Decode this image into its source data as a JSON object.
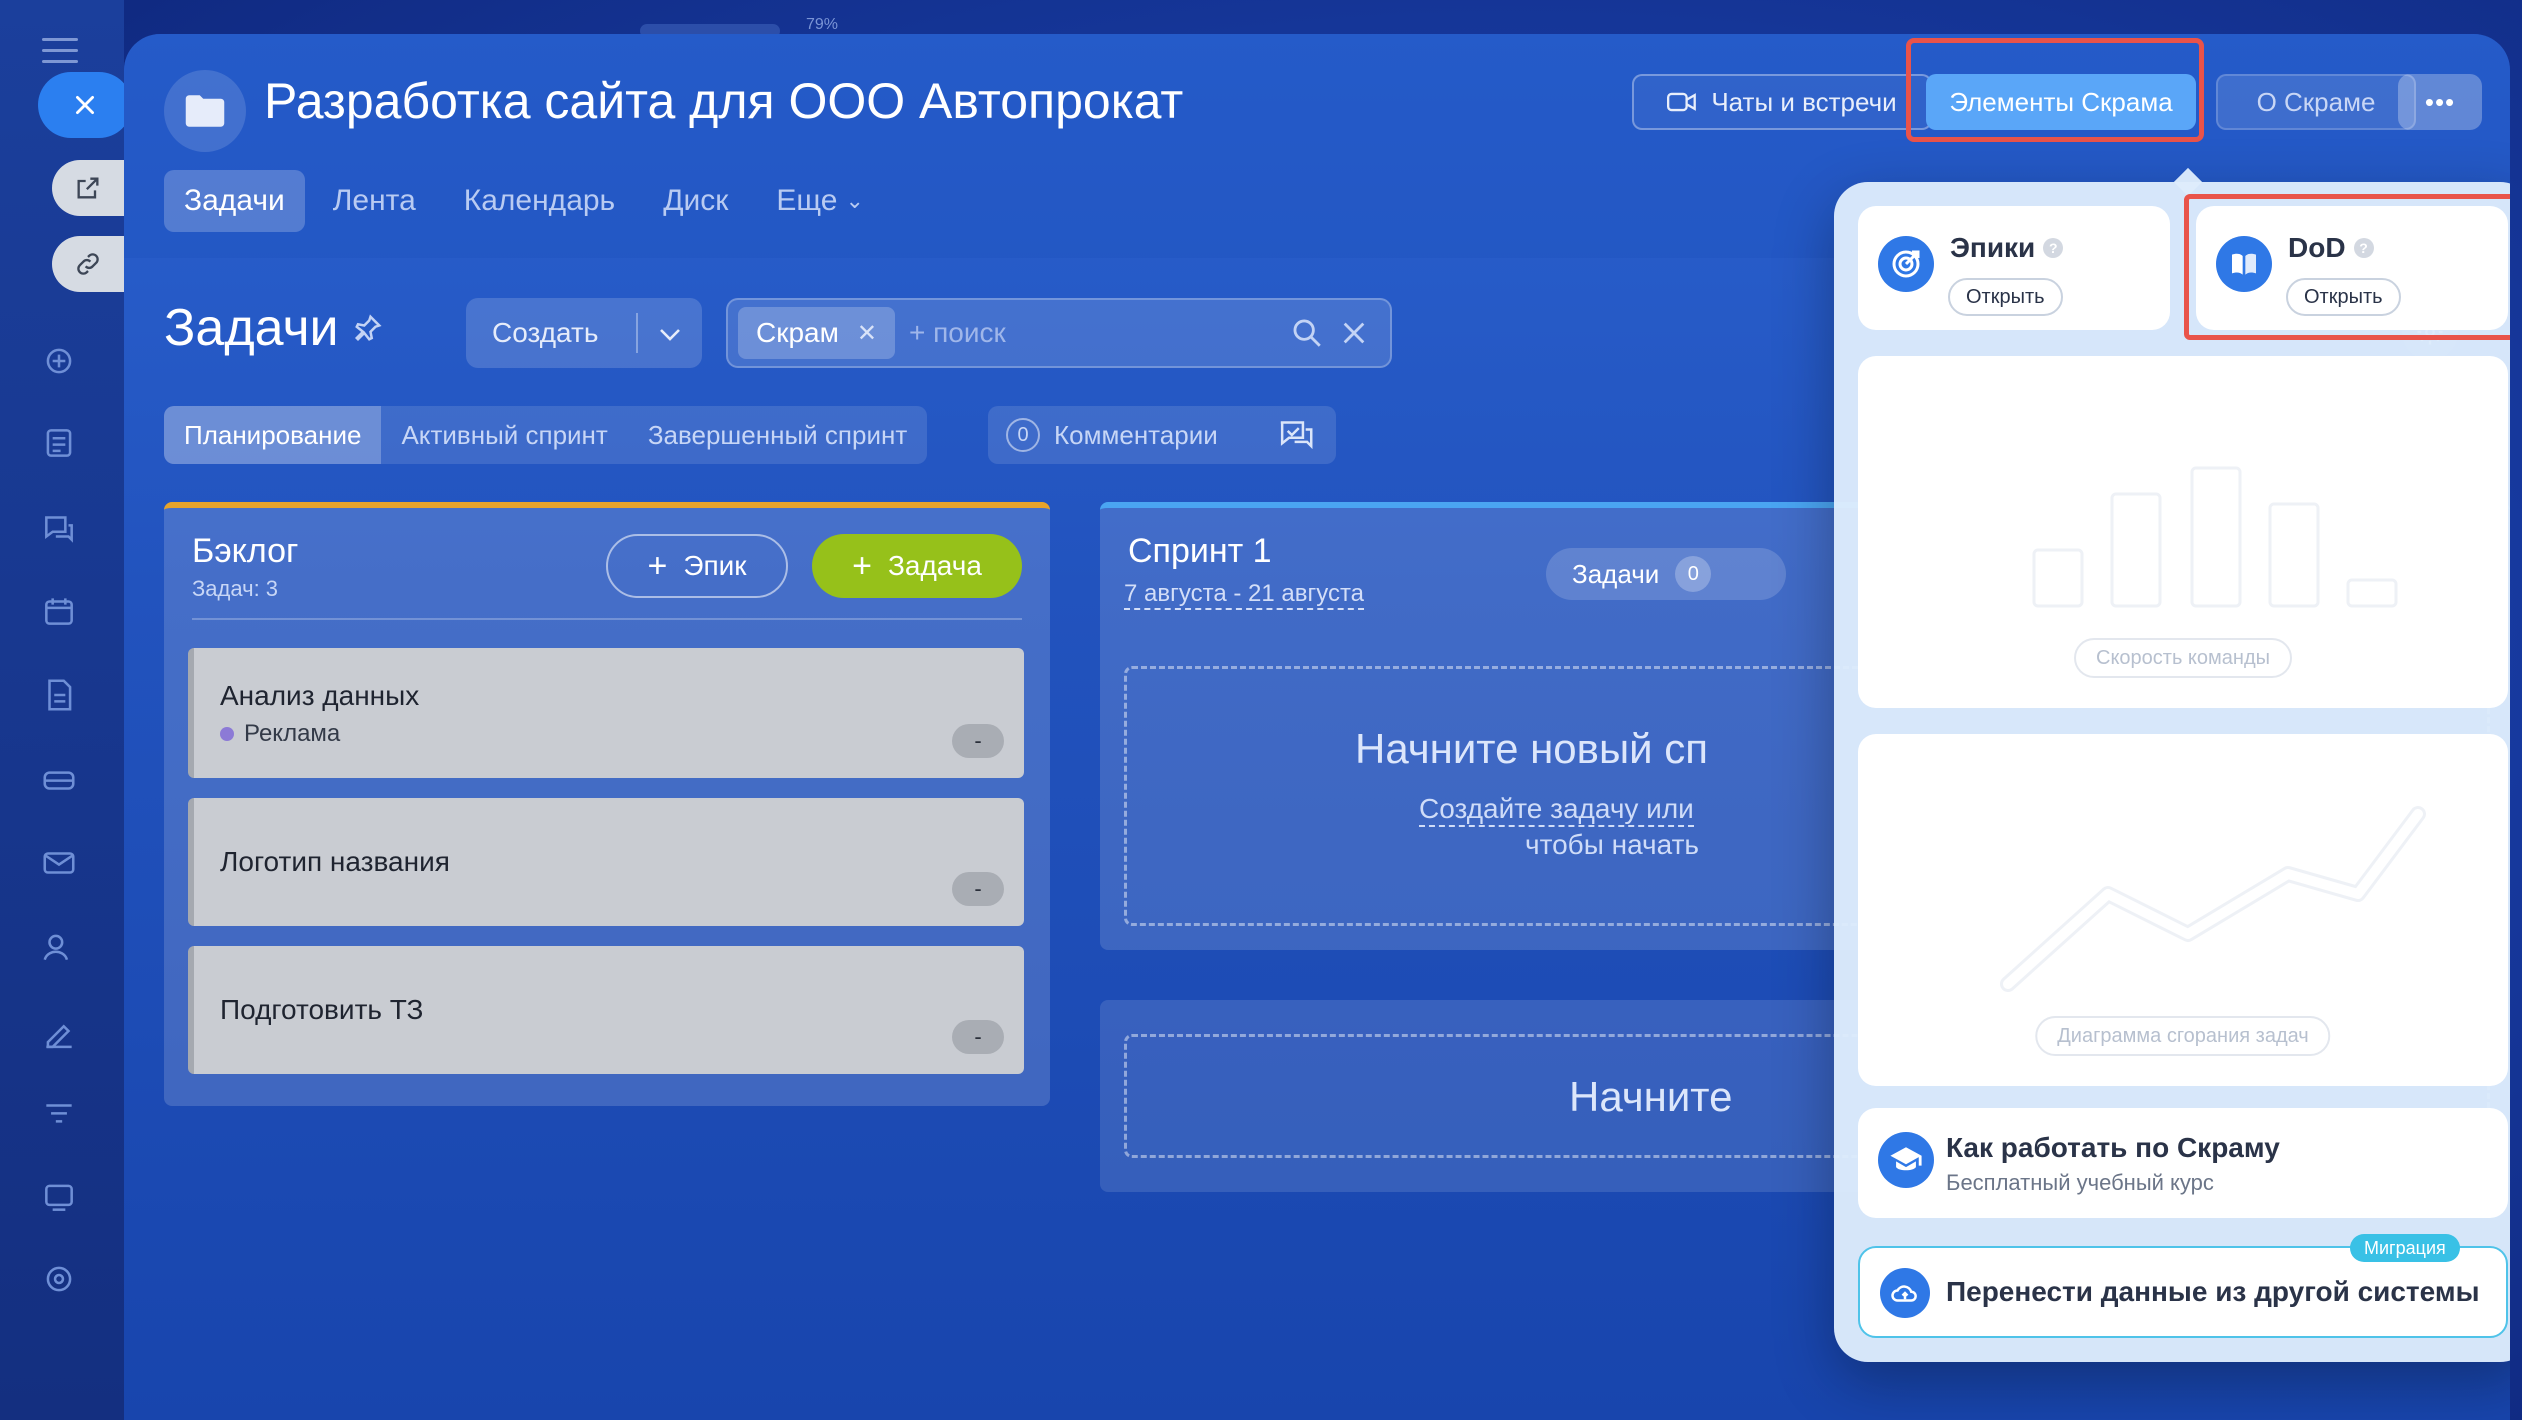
{
  "topbar": {
    "zoom": "79%"
  },
  "window": {
    "title": "Разработка сайта для ООО Автопрокат",
    "buttons": {
      "chats": "Чаты и встречи",
      "scrum_elements": "Элементы Скрама",
      "about_scrum": "О Скраме",
      "more": "•••"
    },
    "tabs": [
      {
        "label": "Задачи",
        "active": true
      },
      {
        "label": "Лента"
      },
      {
        "label": "Календарь"
      },
      {
        "label": "Диск"
      },
      {
        "label": "Еще"
      }
    ]
  },
  "toolbar": {
    "title": "Задачи",
    "create_label": "Создать",
    "search": {
      "chip": "Скрам",
      "placeholder": "+ поиск"
    }
  },
  "subtabs": [
    {
      "label": "Планирование",
      "active": true
    },
    {
      "label": "Активный спринт"
    },
    {
      "label": "Завершенный спринт"
    }
  ],
  "comments": {
    "count": "0",
    "label": "Комментарии"
  },
  "backlog": {
    "title": "Бэклог",
    "count_label": "Задач: 3",
    "epic_button": "Эпик",
    "task_button": "Задача",
    "tasks": [
      {
        "name": "Анализ данных",
        "tag": "Реклама",
        "estimate": "-"
      },
      {
        "name": "Логотип названия",
        "estimate": "-"
      },
      {
        "name": "Подготовить ТЗ",
        "estimate": "-"
      }
    ]
  },
  "sprint": {
    "title": "Спринт 1",
    "dates": "7 августа - 21 августа",
    "tasks_label": "Задачи",
    "tasks_count": "0",
    "empty_title": "Начните новый сп",
    "empty_sub1": "Создайте задачу или",
    "empty_sub2": "чтобы начать"
  },
  "sprint2": {
    "empty_title": "Начните"
  },
  "scrum_panel": {
    "epics": {
      "title": "Эпики",
      "open": "Открыть"
    },
    "dod": {
      "title": "DoD",
      "open": "Открыть"
    },
    "velocity_label": "Скорость команды",
    "burndown_label": "Диаграмма сгорания задач",
    "course": {
      "title": "Как работать по Скраму",
      "subtitle": "Бесплатный учебный курс"
    },
    "migration": {
      "badge": "Миграция",
      "title": "Перенести данные из другой системы"
    }
  },
  "colors": {
    "accent": "#2f78e6",
    "highlight": "#e9534a",
    "task_button": "#96c11a",
    "backlog_border": "#e7a32b"
  }
}
